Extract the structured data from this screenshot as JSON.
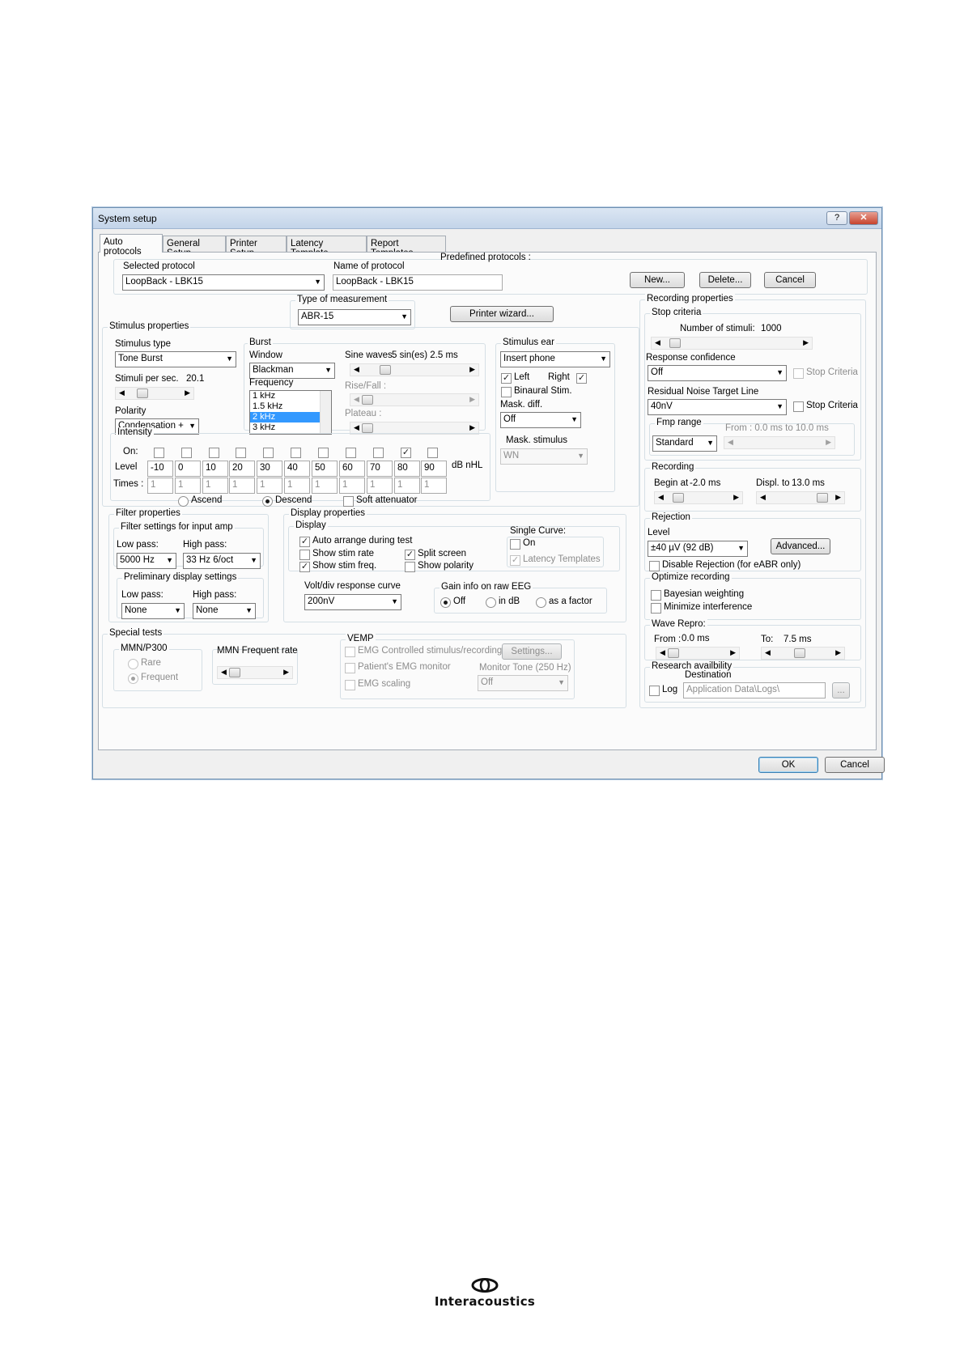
{
  "window": {
    "title": "System setup",
    "help_label": "?",
    "close_label": "✕"
  },
  "tabs": [
    "Auto protocols",
    "General Setup",
    "Printer Setup",
    "Latency Template",
    "Report Templates"
  ],
  "protocol": {
    "selected_label": "Selected protocol",
    "selected_value": "LoopBack - LBK15",
    "name_label": "Name of protocol",
    "name_value": "LoopBack - LBK15",
    "predefined_label": "Predefined protocols :",
    "new_button": "New...",
    "delete_button": "Delete...",
    "cancel_button": "Cancel"
  },
  "measurement": {
    "label": "Type of measurement",
    "value": "ABR-15",
    "printer_wizard": "Printer wizard..."
  },
  "stimulus": {
    "group_label": "Stimulus properties",
    "type_label": "Stimulus type",
    "type_value": "Tone Burst",
    "rate_label": "Stimuli per sec.",
    "rate_value": "20.1",
    "polarity_label": "Polarity",
    "polarity_value": "Condensation +",
    "burst_label": "Burst",
    "window_label": "Window",
    "window_value": "Blackman",
    "sine_label": "Sine waves",
    "sine_value": "5 sin(es) 2.5 ms",
    "frequency_label": "Frequency",
    "frequencies": [
      "1 kHz",
      "1.5 kHz",
      "2 kHz",
      "3 kHz"
    ],
    "frequency_selected": 2,
    "rise_label": "Rise/Fall :",
    "plateau_label": "Plateau :",
    "ear_label": "Stimulus ear",
    "ear_value": "Insert phone",
    "left_label": "Left",
    "right_label": "Right",
    "binaural_label": "Binaural Stim.",
    "mask_diff_label": "Mask. diff.",
    "mask_diff_value": "Off",
    "mask_stim_label": "Mask. stimulus",
    "mask_stim_value": "WN",
    "intensity_label": "Intensity",
    "on_label": "On:",
    "level_label": "Level",
    "times_label": "Times :",
    "levels": [
      "-10",
      "0",
      "10",
      "20",
      "30",
      "40",
      "50",
      "60",
      "70",
      "80",
      "90"
    ],
    "level_on": [
      false,
      false,
      false,
      false,
      false,
      false,
      false,
      false,
      false,
      true,
      false
    ],
    "times": [
      "1",
      "1",
      "1",
      "1",
      "1",
      "1",
      "1",
      "1",
      "1",
      "1",
      "1"
    ],
    "unit_label": "dB nHL",
    "ascend_label": "Ascend",
    "descend_label": "Descend",
    "soft_label": "Soft attenuator"
  },
  "filter": {
    "group_label": "Filter properties",
    "input_label": "Filter settings for input amp",
    "low_label": "Low pass:",
    "low_value": "5000 Hz",
    "high_label": "High pass:",
    "high_value": "33 Hz 6/oct",
    "prelim_label": "Preliminary display settings",
    "prelim_low_label": "Low pass:",
    "prelim_low_value": "None",
    "prelim_high_label": "High pass:",
    "prelim_high_value": "None"
  },
  "display": {
    "group_label": "Display properties",
    "display_label": "Display",
    "auto_arrange": "Auto arrange during test",
    "show_stim_rate": "Show stim rate",
    "show_stim_freq": "Show stim freq.",
    "split_screen": "Split screen",
    "show_polarity": "Show polarity",
    "single_curve_label": "Single Curve:",
    "on_label": "On",
    "latency_templates": "Latency Templates",
    "volt_label": "Volt/div response curve",
    "volt_value": "200nV",
    "gain_label": "Gain info on raw EEG",
    "gain_off": "Off",
    "gain_db": "in dB",
    "gain_factor": "as a factor"
  },
  "special": {
    "group_label": "Special tests",
    "mmn_label": "MMN/P300",
    "rare_label": "Rare",
    "frequent_label": "Frequent",
    "mmn_rate_label": "MMN Frequent rate",
    "vemp_label": "VEMP",
    "emg_controlled": "EMG Controlled stimulus/recording",
    "settings_button": "Settings...",
    "emg_monitor": "Patient's EMG monitor",
    "monitor_tone_label": "Monitor Tone (250 Hz)",
    "monitor_tone_value": "Off",
    "emg_scaling": "EMG scaling"
  },
  "recording_props": {
    "group_label": "Recording properties",
    "stop_label": "Stop criteria",
    "num_stimuli_label": "Number of stimuli:",
    "num_stimuli_value": "1000",
    "confidence_label": "Response confidence",
    "confidence_value": "Off",
    "stop_criteria_label": "Stop Criteria",
    "residual_label": "Residual Noise Target Line",
    "residual_value": "40nV",
    "fmp_label": "Fmp range",
    "fmp_value": "Standard",
    "fmp_range_text": "From : 0.0 ms to 10.0 ms",
    "recording_label": "Recording",
    "begin_label": "Begin at",
    "begin_value": "-2.0 ms",
    "displ_label": "Displ. to",
    "displ_value": "13.0 ms",
    "rejection_label": "Rejection",
    "level_label": "Level",
    "level_value": "±40 µV (92 dB)",
    "advanced_button": "Advanced...",
    "disable_rejection": "Disable Rejection (for eABR only)",
    "optimize_label": "Optimize recording",
    "bayesian_label": "Bayesian weighting",
    "minimize_label": "Minimize interference",
    "wave_label": "Wave Repro:",
    "from_label": "From :",
    "from_value": "0.0 ms",
    "to_label": "To:",
    "to_value": "7.5 ms",
    "research_label": "Research availbility",
    "destination_label": "Destination",
    "log_label": "Log",
    "destination_value": "Application Data\\Logs\\",
    "browse_label": "..."
  },
  "footer": {
    "ok_button": "OK",
    "cancel_button": "Cancel"
  },
  "branding": {
    "company": "Interacoustics"
  }
}
